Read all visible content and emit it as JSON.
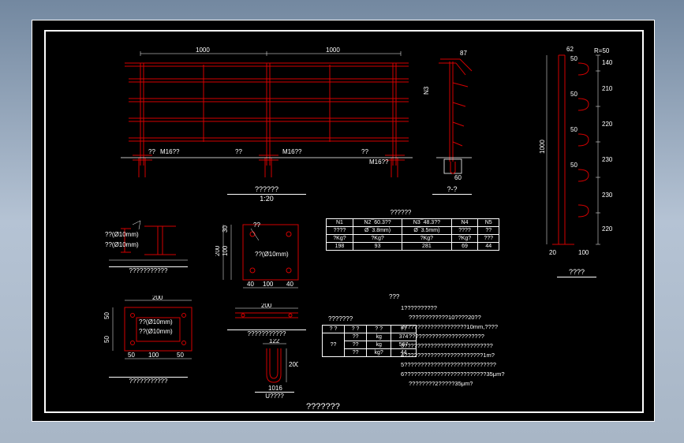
{
  "dimensions": {
    "d1000a": "1000",
    "d1000b": "1000",
    "d1000c": "1000",
    "r50": "R=50",
    "d62": "62",
    "d50_1": "50",
    "d50_2": "50",
    "d50_3": "50",
    "d50_4": "50",
    "d140": "140",
    "d210": "210",
    "d220_1": "220",
    "d220_2": "220",
    "d230_1": "230",
    "d230_2": "230",
    "d20": "20",
    "d100_1": "100",
    "d100_2": "100",
    "d30": "30",
    "d200_1": "200",
    "d200_2": "200",
    "d200_3": "200",
    "d40_1": "40",
    "d40_2": "40",
    "d122": "122",
    "d60": "60",
    "d50_base1": "50",
    "d50_base2": "50",
    "d50_b": "50",
    "d50_c": "50"
  },
  "labels": {
    "m16_1": "M16??",
    "m16_2": "M16??",
    "m16_3": "M16??",
    "scale120": "??????",
    "scale120_num": "1:20",
    "section1": "?-?",
    "section2": "?-?",
    "section3": "????",
    "n1": "N1",
    "n2": "N2",
    "n3": "N3",
    "n4": "N4",
    "n5": "N5",
    "d10mm": "??(Ø10mm)",
    "bolt1": "??(Ø10mm)",
    "bolt2": "??(Ø10mm)",
    "thick10": "??(Ø10mm)",
    "ubolt": "U????",
    "dplate1": "???????????",
    "dplate2": "???????????",
    "dplate3": "???????????",
    "matlabel": "???????",
    "page_title": "???????",
    "notes_title": "???",
    "spec_table": "??????"
  },
  "material_table": {
    "header": [
      "N1",
      "N2¯60.3??",
      "N3¯48.3??",
      "N4",
      "N5"
    ],
    "row1": [
      "????",
      "Ø¯3.8mm)",
      "Ø¯3.5mm)",
      "????",
      "??"
    ],
    "row2": [
      "?Kg?",
      "?Kg?",
      "?Kg?",
      "?Kg?",
      "???"
    ],
    "row3": [
      "198",
      "93",
      "281",
      "69",
      "44"
    ]
  },
  "weight_table": {
    "header": [
      "? ?",
      "? ?",
      "? ?",
      "??"
    ],
    "rows": [
      [
        "??",
        "??",
        "kg",
        "374"
      ],
      [
        "",
        "??",
        "kg",
        "567"
      ],
      [
        "",
        "??",
        "kg?",
        "44"
      ]
    ]
  },
  "notes": {
    "n1": "1??????????",
    "n2": "????????????10????20??",
    "n3": "2???????????????????10mm,????",
    "n4": "???????????????????????",
    "n5": "3???????????????????????????",
    "n6": "4????????????????????????1m?",
    "n7": "5????????????????????????????",
    "n8": "6?????????????????????????35μm?",
    "n9": "????????2?????35μm?"
  }
}
